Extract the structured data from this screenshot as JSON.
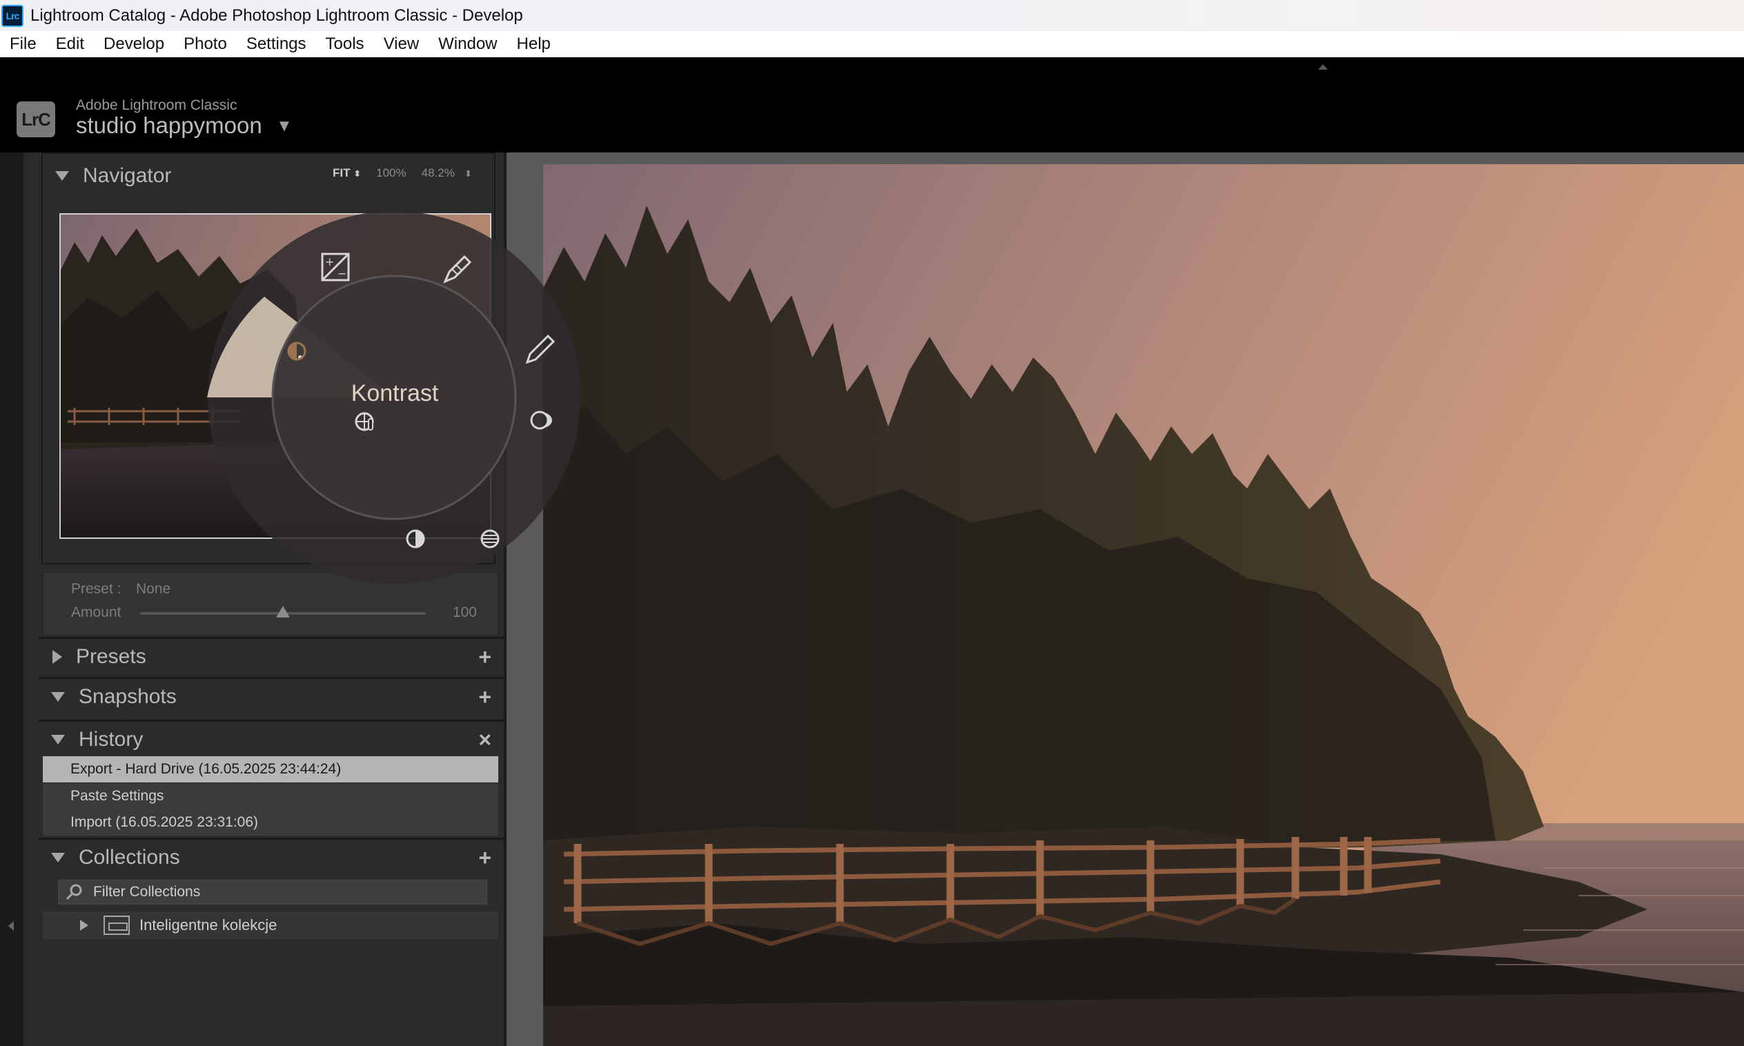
{
  "window": {
    "title": "Lightroom Catalog - Adobe Photoshop Lightroom Classic - Develop",
    "app_icon_text": "Lrc"
  },
  "menu": [
    "File",
    "Edit",
    "Develop",
    "Photo",
    "Settings",
    "Tools",
    "View",
    "Window",
    "Help"
  ],
  "identity": {
    "logo_text": "LrC",
    "subtitle": "Adobe Lightroom Classic",
    "title": "studio happymoon",
    "dropdown_glyph": "▼"
  },
  "navigator": {
    "title": "Navigator",
    "zoom_fit": "FIT",
    "zoom_100": "100%",
    "zoom_custom": "48.2%",
    "zoom_arrows": "⬍"
  },
  "preset": {
    "label": "Preset :",
    "value": "None",
    "amount_label": "Amount",
    "amount_value": "100",
    "amount_fraction": 0.5
  },
  "panels": {
    "presets": {
      "title": "Presets",
      "action": "+"
    },
    "snapshots": {
      "title": "Snapshots",
      "action": "+"
    },
    "history": {
      "title": "History",
      "action": "×"
    },
    "collections": {
      "title": "Collections",
      "action": "+"
    }
  },
  "history": [
    "Export - Hard Drive (16.05.2025 23:44:24)",
    "Paste Settings",
    "Import (16.05.2025 23:31:06)"
  ],
  "collections": {
    "filter_placeholder": "Filter Collections",
    "items": [
      "Inteligentne kolekcje"
    ]
  },
  "radial_menu": {
    "center_label": "Kontrast",
    "icons": [
      "exposure-icon",
      "brush-icon",
      "pencil-icon",
      "highlights-icon",
      "stripes-icon",
      "contrast-icon",
      "temperature-icon",
      "half-circle-icon"
    ]
  },
  "colors": {
    "panel_bg": "#2b2b2b",
    "history_selected": "#b5b5b5",
    "sky_top": "#8c7078",
    "sky_right": "#d39c7a"
  }
}
